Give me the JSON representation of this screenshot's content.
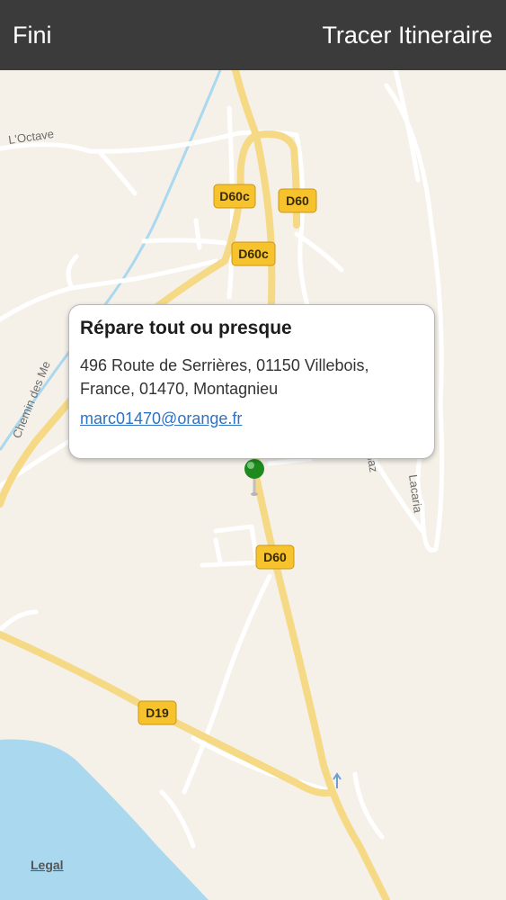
{
  "nav": {
    "left_label": "Fini",
    "right_label": "Tracer Itineraire"
  },
  "map": {
    "road_shields": {
      "d60c_top": "D60c",
      "d60_top": "D60",
      "d60c_mid": "D60c",
      "d60_mid": "D60",
      "d19": "D19"
    },
    "street_labels": {
      "octave": "L'Octave",
      "chemin": "Chemin des Me",
      "route": "Route la Cuenaz",
      "lacaria": "Lacaria"
    },
    "pin_color": "#1e8a1e",
    "legal": "Legal"
  },
  "callout": {
    "title": "Répare tout ou presque",
    "address_line1": "496 Route de Serrières, 01150 Villebois,",
    "address_line2": "France, 01470, Montagnieu",
    "email": "marc01470@orange.fr"
  },
  "colors": {
    "nav_bg": "#3b3b3b",
    "land": "#f5f1e9",
    "water": "#aad8ef",
    "major_road": "#f5d985",
    "shield": "#f6c32c",
    "link": "#2b73c7"
  }
}
